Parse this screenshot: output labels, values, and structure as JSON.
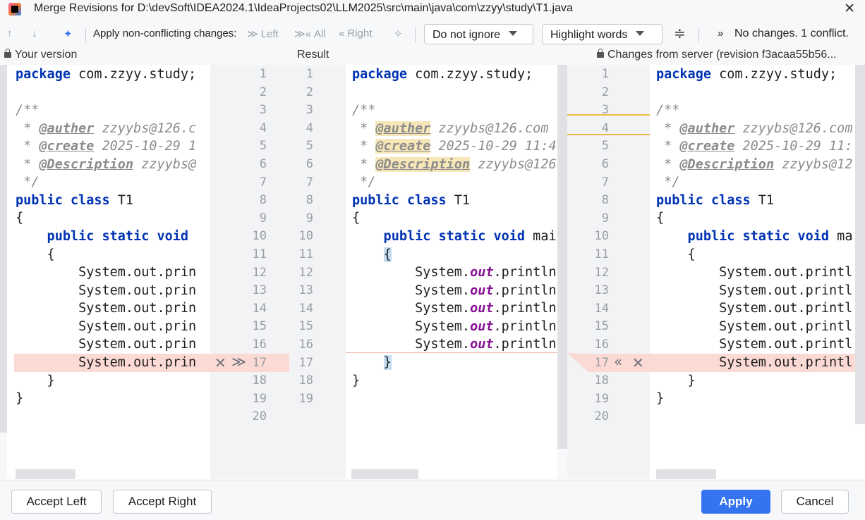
{
  "window": {
    "title": "Merge Revisions for D:\\devSoft\\IDEA2024.1\\IdeaProjects02\\LLM2025\\src\\main\\java\\com\\zzyy\\study\\T1.java",
    "close_glyph": "✕"
  },
  "toolbar": {
    "up_glyph": "↑",
    "down_glyph": "↓",
    "magic_glyph": "✦",
    "apply_label": "Apply non-conflicting changes:",
    "left_glyph": "≫",
    "left_label": "Left",
    "all_glyph": "≫«",
    "all_label": "All",
    "right_glyph": "«",
    "right_label": "Right",
    "wand_glyph": "✧",
    "ignore_value": "Do not ignore",
    "highlight_value": "Highlight words",
    "collapse_glyph": "≑",
    "more_glyph": "»",
    "status": "No changes. 1 conflict."
  },
  "panes": {
    "left_title": "Your version",
    "center_title": "Result",
    "right_title": "Changes from server (revision f3acaa55b56..."
  },
  "markers": {
    "left_reject": "✕",
    "left_accept": "≫",
    "right_accept": "«",
    "right_reject": "✕"
  },
  "left_lines": {
    "l1_kw": "package",
    "l1_rest": " com.zzyy.study;",
    "l3": "/**",
    "l4_pre": " * ",
    "l4_tag": "@auther",
    "l4_rest": " zzyybs@126.c",
    "l5_pre": " * ",
    "l5_tag": "@create",
    "l5_rest": " 2025-10-29 1",
    "l6_pre": " * ",
    "l6_tag": "@Description",
    "l6_rest": " zzyybs@",
    "l7": " */",
    "l8_kw": "public class",
    "l8_rest": " T1",
    "l9": "{",
    "l10_kw": "    public static void",
    "l11": "    {",
    "l12": "        System.out.prin",
    "l13": "        System.out.prin",
    "l14": "        System.out.prin",
    "l15": "        System.out.prin",
    "l16": "        System.out.prin",
    "l17": "        System.out.prin",
    "l18": "    }",
    "l19": "}"
  },
  "center_lines": {
    "l1_kw": "package",
    "l1_rest": " com.zzyy.study;",
    "l3": "/**",
    "l4_pre": " * ",
    "l4_tag": "@auther",
    "l4_rest": " zzyybs@126.com",
    "l5_pre": " * ",
    "l5_tag": "@create",
    "l5_rest": " 2025-10-29 11:4",
    "l6_pre": " * ",
    "l6_tag": "@Description",
    "l6_rest": " zzyybs@126",
    "l7": " */",
    "l8_kw": "public class",
    "l8_rest": " T1",
    "l9": "{",
    "l10_kw": "    public static void",
    "l10_rest": " mai",
    "l11_pre": "    ",
    "l11_brace": "{",
    "sys_pre": "        System.",
    "sys_fld": "out",
    "sys_post": ".println",
    "l17_pre": "    ",
    "l17_brace": "}",
    "l18": "}"
  },
  "right_lines": {
    "l1_kw": "package",
    "l1_rest": " com.zzyy.study;",
    "l3": "/**",
    "l4_pre": " * ",
    "l4_tag": "@auther",
    "l4_rest": " zzyybs@126.com",
    "l5_pre": " * ",
    "l5_tag": "@create",
    "l5_rest": " 2025-10-29 11:",
    "l6_pre": " * ",
    "l6_tag": "@Description",
    "l6_rest": " zzyybs@12",
    "l7": " */",
    "l8_kw": "public class",
    "l8_rest": " T1",
    "l9": "{",
    "l10_kw": "    public static void",
    "l10_rest": " ma",
    "l11": "    {",
    "l12": "        System.out.printl",
    "l13": "        System.out.printl",
    "l14": "        System.out.printl",
    "l15": "        System.out.printl",
    "l16": "        System.out.printl",
    "l17": "        System.out.printl",
    "l18": "    }",
    "l19": "}"
  },
  "gutter_left_numbers": [
    "1",
    "2",
    "3",
    "4",
    "5",
    "6",
    "7",
    "8",
    "9",
    "10",
    "11",
    "12",
    "13",
    "14",
    "15",
    "16",
    "17",
    "18",
    "19",
    "20"
  ],
  "gutter_result_numbers": [
    "1",
    "2",
    "3",
    "4",
    "5",
    "6",
    "7",
    "8",
    "9",
    "10",
    "11",
    "12",
    "13",
    "14",
    "15",
    "16",
    "17",
    "18",
    "19"
  ],
  "gutter_right_numbers": [
    "1",
    "2",
    "3",
    "4",
    "5",
    "6",
    "7",
    "8",
    "9",
    "10",
    "11",
    "12",
    "13",
    "14",
    "15",
    "16",
    "17",
    "18",
    "19",
    "20"
  ],
  "buttons": {
    "accept_left": "Accept Left",
    "accept_right": "Accept Right",
    "apply": "Apply",
    "cancel": "Cancel"
  },
  "colors": {
    "accent": "#3574f0",
    "conflict": "#fbd9d5",
    "keyword": "#0033b3",
    "field": "#871094"
  }
}
